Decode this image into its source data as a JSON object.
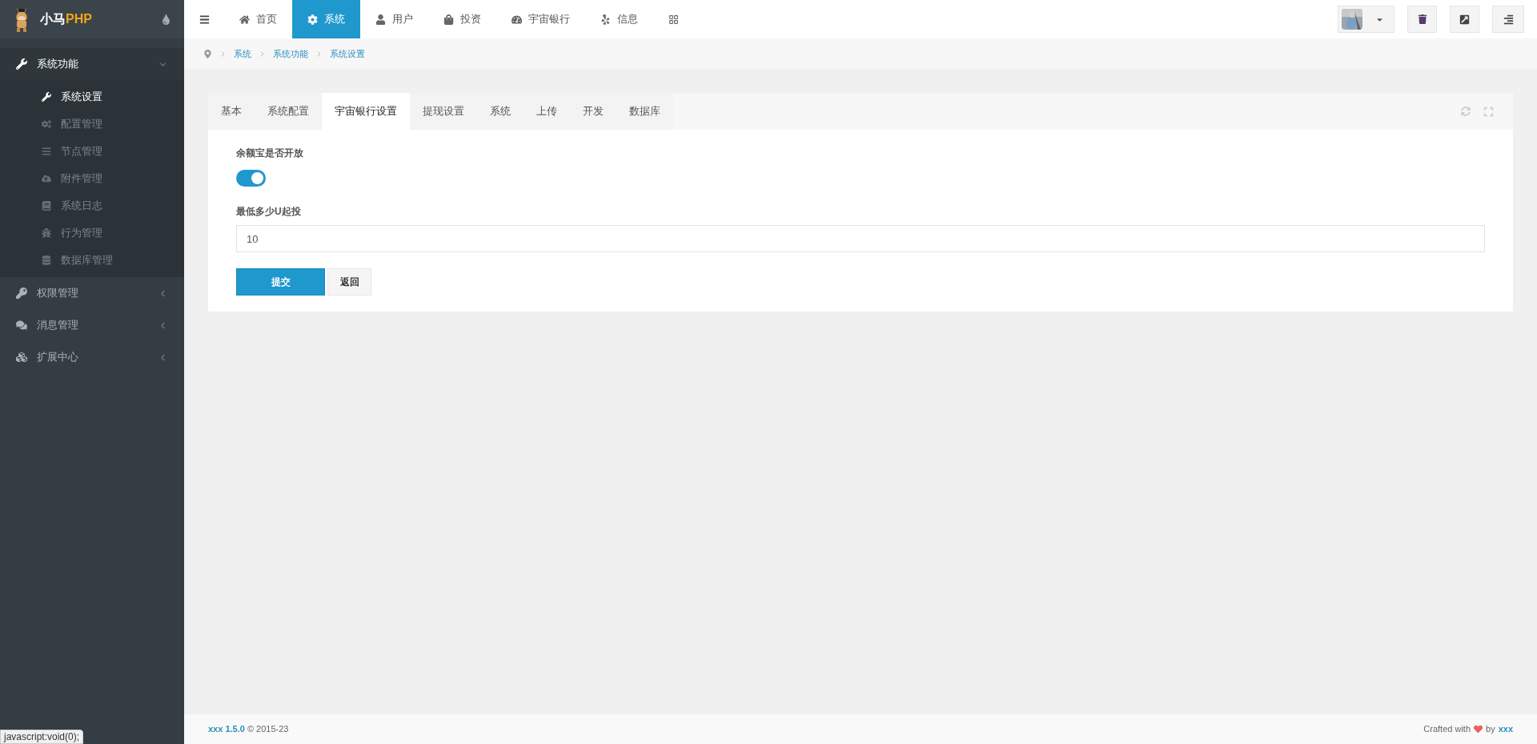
{
  "logo": {
    "text_main": "小马",
    "text_accent": "PHP"
  },
  "top_nav": [
    {
      "label": "首页",
      "selected": false
    },
    {
      "label": "系统",
      "selected": true
    },
    {
      "label": "用户",
      "selected": false
    },
    {
      "label": "投资",
      "selected": false
    },
    {
      "label": "宇宙银行",
      "selected": false
    },
    {
      "label": "信息",
      "selected": false
    },
    {
      "selected": false
    }
  ],
  "sidebar": [
    {
      "label": "系统功能",
      "expanded": true,
      "children": [
        {
          "label": "系统设置",
          "selected": true
        },
        {
          "label": "配置管理",
          "selected": false
        },
        {
          "label": "节点管理",
          "selected": false
        },
        {
          "label": "附件管理",
          "selected": false
        },
        {
          "label": "系统日志",
          "selected": false
        },
        {
          "label": "行为管理",
          "selected": false
        },
        {
          "label": "数据库管理",
          "selected": false
        }
      ]
    },
    {
      "label": "权限管理",
      "expanded": false
    },
    {
      "label": "消息管理",
      "expanded": false
    },
    {
      "label": "扩展中心",
      "expanded": false
    }
  ],
  "breadcrumb": [
    "系统",
    "系统功能",
    "系统设置"
  ],
  "tabs": [
    {
      "label": "基本",
      "selected": false
    },
    {
      "label": "系统配置",
      "selected": false
    },
    {
      "label": "宇宙银行设置",
      "selected": true
    },
    {
      "label": "提现设置",
      "selected": false
    },
    {
      "label": "系统",
      "selected": false
    },
    {
      "label": "上传",
      "selected": false
    },
    {
      "label": "开发",
      "selected": false
    },
    {
      "label": "数据库",
      "selected": false
    }
  ],
  "form": {
    "switch": {
      "label": "余额宝是否开放",
      "on": true
    },
    "field": {
      "label": "最低多少U起投",
      "value": "10"
    },
    "submit": "提交",
    "back": "返回"
  },
  "footer": {
    "brand": "xxx 1.5.0",
    "copyright": "© 2015-23",
    "crafted": "Crafted with",
    "by": "by",
    "author": "xxx"
  },
  "status_tip": "javascript:void(0);"
}
